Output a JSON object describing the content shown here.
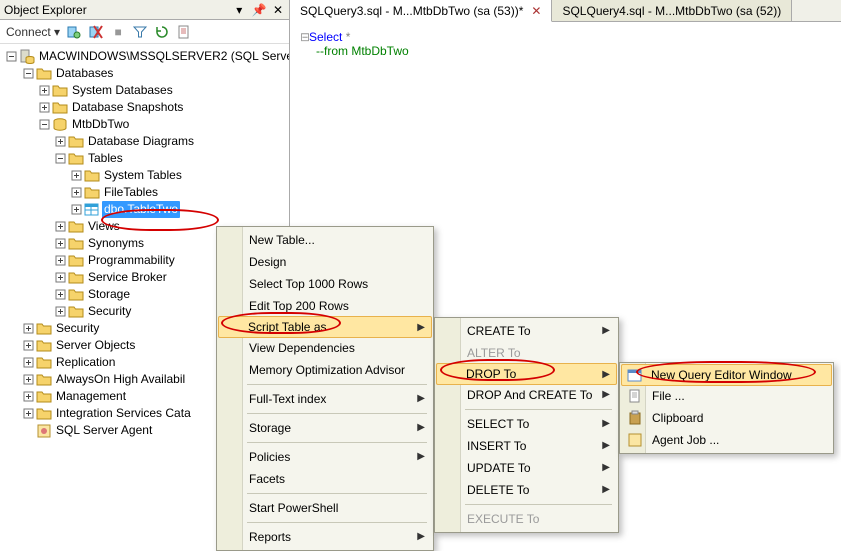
{
  "panel": {
    "title": "Object Explorer",
    "connect_label": "Connect"
  },
  "tree": {
    "server": "MACWINDOWS\\MSSQLSERVER2 (SQL Serve",
    "databases": "Databases",
    "system_db": "System Databases",
    "snapshots": "Database Snapshots",
    "db": "MtbDbTwo",
    "diagrams": "Database Diagrams",
    "tables": "Tables",
    "system_tables": "System Tables",
    "file_tables": "FileTables",
    "table_two": "dbo.TableTwo",
    "views": "Views",
    "synonyms": "Synonyms",
    "programmability": "Programmability",
    "service_broker": "Service Broker",
    "storage": "Storage",
    "security": "Security",
    "top_security": "Security",
    "server_objects": "Server Objects",
    "replication": "Replication",
    "alwayson": "AlwaysOn High Availabil",
    "management": "Management",
    "isc": "Integration Services Cata",
    "agent": "SQL Server Agent"
  },
  "tabs": {
    "active": "SQLQuery3.sql - M...MtbDbTwo (sa (53))*",
    "inactive": "SQLQuery4.sql - M...MtbDbTwo (sa (52))"
  },
  "code": {
    "l1a": "Select",
    "l1b": " *",
    "l2": "--from MtbDbTwo"
  },
  "menu1": {
    "new_table": "New Table...",
    "design": "Design",
    "select_top": "Select Top 1000 Rows",
    "edit_top": "Edit Top 200 Rows",
    "script_table": "Script Table as",
    "view_deps": "View Dependencies",
    "mem_opt": "Memory Optimization Advisor",
    "fulltext": "Full-Text index",
    "storage": "Storage",
    "policies": "Policies",
    "facets": "Facets",
    "powershell": "Start PowerShell",
    "reports": "Reports"
  },
  "menu2": {
    "create": "CREATE To",
    "alter": "ALTER To",
    "drop": "DROP To",
    "drop_create": "DROP And CREATE To",
    "select": "SELECT To",
    "insert": "INSERT To",
    "update": "UPDATE To",
    "delete": "DELETE To",
    "execute": "EXECUTE To"
  },
  "menu3": {
    "new_query": "New Query Editor Window",
    "file": "File ...",
    "clipboard": "Clipboard",
    "agent": "Agent Job ..."
  }
}
